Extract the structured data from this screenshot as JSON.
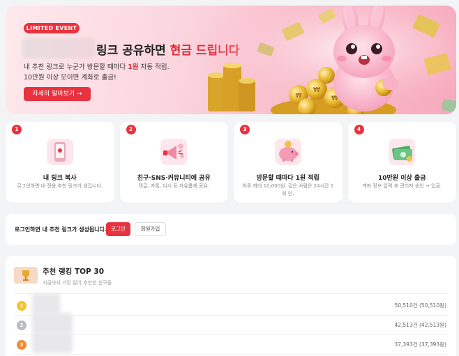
{
  "hero": {
    "badge": "LIMITED EVENT",
    "title_prefix": "링크 공유하면 ",
    "title_highlight": "현금 드립니다",
    "desc_line1_a": "내 추천 링크로 누군가 방문할 때마다 ",
    "desc_line1_em": "1원",
    "desc_line1_b": " 자동 적립.",
    "desc_line2": "10만원 이상 모이면 계좌로 출금!",
    "cta": "자세히 알아보기 →"
  },
  "steps": [
    {
      "num": "1",
      "title": "내 링크 복사",
      "desc": "로그인하면 내 전용 추천 링크가 생깁니다.",
      "icon": "phone-link-icon"
    },
    {
      "num": "2",
      "title": "친구·SNS·커뮤니티에 공유",
      "desc": "댓글, 카톡, 디시 등 자유롭게 공유.",
      "icon": "share-megaphone-icon"
    },
    {
      "num": "3",
      "title": "방문할 때마다 1원 적립",
      "desc": "하루 최대 10,000원. 같은 사람은 24시간 1회 인.",
      "icon": "piggy-bank-icon"
    },
    {
      "num": "4",
      "title": "10만원 이상 출금",
      "desc": "계좌 정보 입력 후 관리자 승인 → 입금.",
      "icon": "cash-withdraw-icon"
    }
  ],
  "login": {
    "text": "로그인하면 내 추천 링크가 생성됩니다.",
    "login_label": "로그인",
    "signup_label": "회원가입"
  },
  "ranking": {
    "title": "추천 랭킹 TOP 30",
    "subtitle": "지금까지 가장 많이 추천한 친구들",
    "rows": [
      {
        "rank": "1",
        "count": "50,510건 (50,510원)",
        "color": "#f4c430"
      },
      {
        "rank": "2",
        "count": "42,513건 (42,513원)",
        "color": "#b8bcc6"
      },
      {
        "rank": "3",
        "count": "37,393건 (37,393원)",
        "color": "#ef8d3a"
      }
    ]
  },
  "colors": {
    "accent": "#e8323f",
    "hero_bg": "#f9c3d0"
  }
}
